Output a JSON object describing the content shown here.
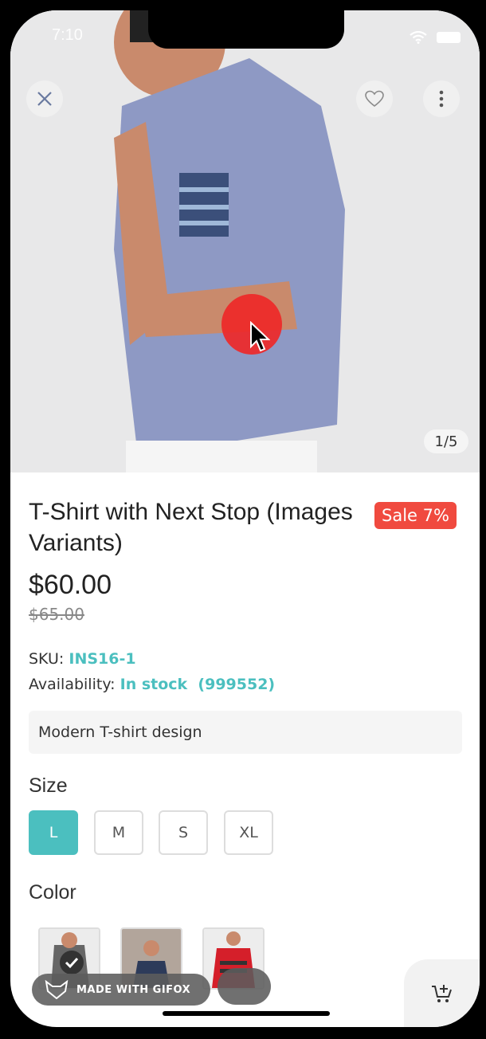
{
  "status": {
    "time": "7:10"
  },
  "gallery": {
    "counter": "1/5"
  },
  "product": {
    "title": "T-Shirt with Next Stop (Images Variants)",
    "sale_badge": "Sale 7%",
    "price": "$60.00",
    "old_price": "$65.00",
    "sku_label": "SKU:",
    "sku_value": "INS16-1",
    "availability_label": "Availability:",
    "availability_value": "In stock  (999552)",
    "description": "Modern T-shirt design"
  },
  "size": {
    "label": "Size",
    "options": [
      "L",
      "M",
      "S",
      "XL"
    ],
    "selected": "L"
  },
  "color": {
    "label": "Color",
    "selected_index": 0
  },
  "gifox": {
    "label": "MADE WITH GIFOX"
  },
  "colors": {
    "accent": "#4bbfbf",
    "sale": "#f04a3f"
  }
}
